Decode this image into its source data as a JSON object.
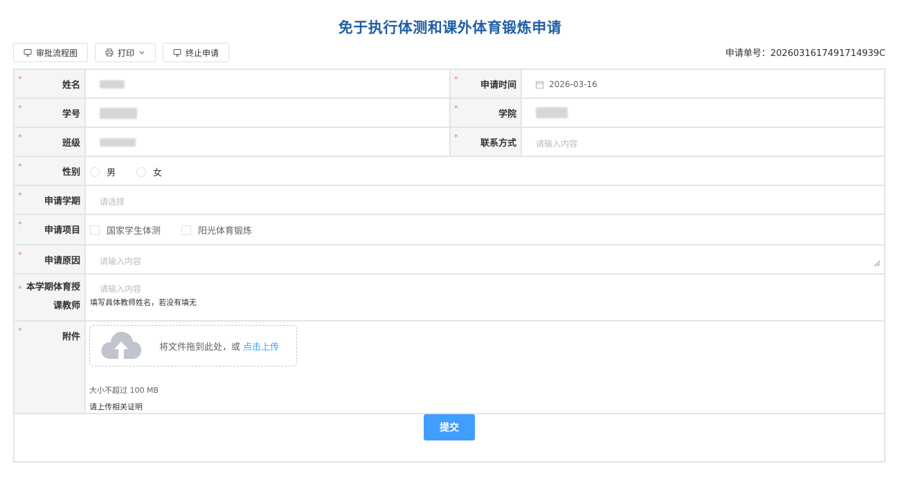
{
  "title": "免于执行体测和课外体育锻炼申请",
  "toolbar": {
    "flow_label": "审批流程图",
    "print_label": "打印",
    "terminate_label": "终止申请"
  },
  "application_no": "申请单号：2026031617491714939C",
  "fields": {
    "name_label": "姓名",
    "time_label": "申请时间",
    "time_value": "2026-03-16",
    "student_id_label": "学号",
    "college_label": "学院",
    "class_label": "班级",
    "contact_label": "联系方式",
    "contact_placeholder": "请输入内容",
    "gender_label": "性别",
    "gender_male": "男",
    "gender_female": "女",
    "semester_label": "申请学期",
    "semester_placeholder": "请选择",
    "project_label": "申请项目",
    "project_opt1": "国家学生体测",
    "project_opt2": "阳光体育锻炼",
    "reason_label": "申请原因",
    "reason_placeholder": "请输入内容",
    "teacher_label_1": "本学期体育授",
    "teacher_label_2": "课教师",
    "teacher_placeholder": "请输入内容",
    "teacher_hint": "填写具体教师姓名，若没有填无",
    "attach_label": "附件",
    "upload_text": "将文件拖到此处，或 ",
    "upload_link": "点击上传",
    "size_hint": "大小不超过 100 MB",
    "proof_hint": "请上传相关证明"
  },
  "submit_label": "提交",
  "required_mark": "*"
}
